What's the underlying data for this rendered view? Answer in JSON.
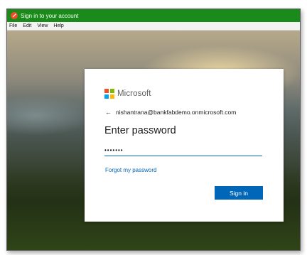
{
  "window": {
    "title": "Sign in to your account"
  },
  "menu": [
    "File",
    "Edit",
    "View",
    "Help"
  ],
  "card": {
    "brand": "Microsoft",
    "back_icon": "arrow-left-icon",
    "account": "nishantrana@bankfabdemo.onmicrosoft.com",
    "heading": "Enter password",
    "password_value": "•••••••",
    "forgot_link": "Forgot my password",
    "signin_label": "Sign in"
  },
  "colors": {
    "titlebar": "#1a8a1a",
    "accent": "#0067b8",
    "ms_red": "#f25022",
    "ms_green": "#7fba00",
    "ms_blue": "#00a4ef",
    "ms_yellow": "#ffb900"
  }
}
